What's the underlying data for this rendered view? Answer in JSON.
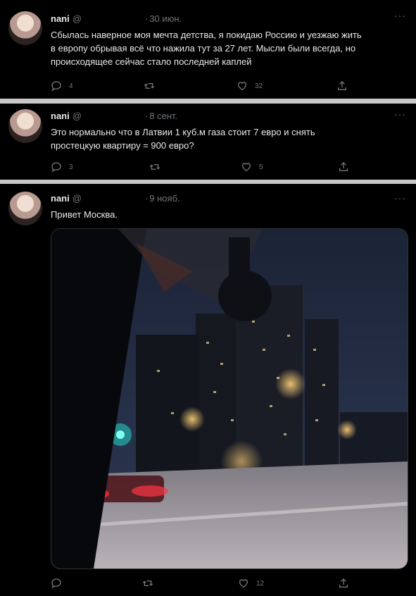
{
  "tweets": [
    {
      "name": "nani",
      "handle": "@",
      "date": "30 июн.",
      "text_lines": [
        "Сбылась наверное моя мечта детства, я покидаю Россию и уезжаю жить",
        "в европу обрывая всё что нажила тут за 27 лет. Мысли были всегда, но",
        "происходящее сейчас стало последней каплей"
      ],
      "replies": "4",
      "retweets": "",
      "likes": "32"
    },
    {
      "name": "nani",
      "handle": "@",
      "date": "8 сент.",
      "text_lines": [
        "Это нормально что в Латвии 1 куб.м газа стоит 7 евро и снять",
        "простецкую квартиру = 900 евро?"
      ],
      "replies": "3",
      "retweets": "",
      "likes": "5"
    },
    {
      "name": "nani",
      "handle": "@",
      "date": "9 нояб.",
      "text_lines": [
        "Привет Москва."
      ],
      "replies": "",
      "retweets": "",
      "likes": "12"
    }
  ],
  "icons": {
    "reply": "speech-bubble-icon",
    "retweet": "retweet-icon",
    "like": "heart-icon",
    "share": "share-icon",
    "more": "more-dots-icon"
  },
  "colors": {
    "background": "#000000",
    "text": "#e7e9ea",
    "muted": "#71767b",
    "separator": "#c8c8c8"
  }
}
